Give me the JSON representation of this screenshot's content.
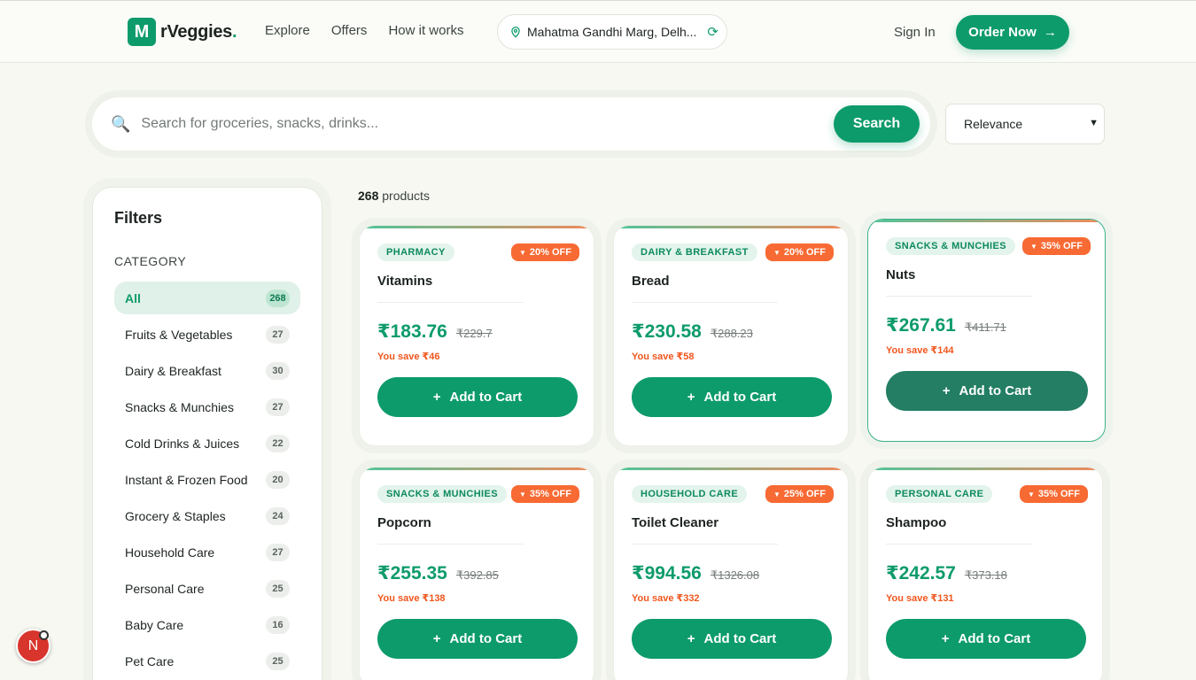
{
  "header": {
    "logo_letter": "M",
    "logo_text": "rVeggies",
    "logo_dot": ".",
    "nav": [
      "Explore",
      "Offers",
      "How it works"
    ],
    "location": "Mahatma Gandhi Marg, Delh...",
    "signin": "Sign In",
    "order_now": "Order Now"
  },
  "search": {
    "placeholder": "Search for groceries, snacks, drinks...",
    "button": "Search",
    "sort_selected": "Relevance"
  },
  "filters": {
    "title": "Filters",
    "category_label": "CATEGORY",
    "categories": [
      {
        "label": "All",
        "count": "268"
      },
      {
        "label": "Fruits & Vegetables",
        "count": "27"
      },
      {
        "label": "Dairy & Breakfast",
        "count": "30"
      },
      {
        "label": "Snacks & Munchies",
        "count": "27"
      },
      {
        "label": "Cold Drinks & Juices",
        "count": "22"
      },
      {
        "label": "Instant & Frozen Food",
        "count": "20"
      },
      {
        "label": "Grocery & Staples",
        "count": "24"
      },
      {
        "label": "Household Care",
        "count": "27"
      },
      {
        "label": "Personal Care",
        "count": "25"
      },
      {
        "label": "Baby Care",
        "count": "16"
      },
      {
        "label": "Pet Care",
        "count": "25"
      }
    ]
  },
  "results": {
    "count": "268",
    "count_suffix": "products"
  },
  "products": [
    {
      "tag": "PHARMACY",
      "off": "20% OFF",
      "name": "Vitamins",
      "price": "₹183.76",
      "mrp": "₹229.7",
      "save": "You save ₹46",
      "button": "Add to Cart"
    },
    {
      "tag": "DAIRY & BREAKFAST",
      "off": "20% OFF",
      "name": "Bread",
      "price": "₹230.58",
      "mrp": "₹288.23",
      "save": "You save ₹58",
      "button": "Add to Cart"
    },
    {
      "tag": "SNACKS & MUNCHIES",
      "off": "35% OFF",
      "name": "Nuts",
      "price": "₹267.61",
      "mrp": "₹411.71",
      "save": "You save ₹144",
      "button": "Add to Cart"
    },
    {
      "tag": "SNACKS & MUNCHIES",
      "off": "35% OFF",
      "name": "Popcorn",
      "price": "₹255.35",
      "mrp": "₹392.85",
      "save": "You save ₹138",
      "button": "Add to Cart"
    },
    {
      "tag": "HOUSEHOLD CARE",
      "off": "25% OFF",
      "name": "Toilet Cleaner",
      "price": "₹994.56",
      "mrp": "₹1326.08",
      "save": "You save ₹332",
      "button": "Add to Cart"
    },
    {
      "tag": "PERSONAL CARE",
      "off": "35% OFF",
      "name": "Shampoo",
      "price": "₹242.57",
      "mrp": "₹373.18",
      "save": "You save ₹131",
      "button": "Add to Cart"
    }
  ],
  "avatar_letter": "N",
  "colors": {
    "brand": "#0d9b6b",
    "discount": "#f86a33",
    "savings": "#f0561d"
  }
}
